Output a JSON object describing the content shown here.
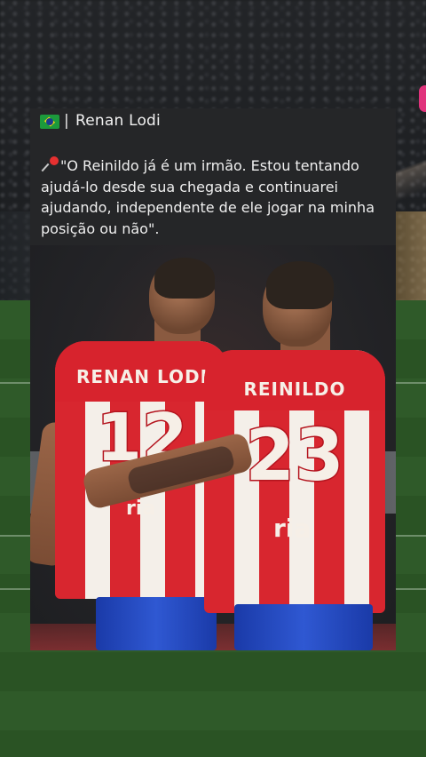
{
  "post": {
    "author_name": "Renan Lodi",
    "separator": "|",
    "flag_icon": "brazil-flag-icon",
    "pin_icon": "round-pushpin-icon",
    "quote": "\"O Reinildo já é um irmão. Estou tentando ajudá-lo desde sua chegada e continuarei ajudando, independente de ele jogar na minha posição ou não\"."
  },
  "photo": {
    "left_player": {
      "jersey_name": "RENAN LODI",
      "jersey_number": "12",
      "sponsor": "ria"
    },
    "right_player": {
      "jersey_name": "REINILDO",
      "jersey_number": "23",
      "sponsor": "ria"
    }
  },
  "colors": {
    "card_bg": "#252628",
    "jersey_red": "#d8262f",
    "jersey_white": "#f4efe9",
    "shorts_blue": "#2f58d2",
    "pitch_green": "#2f5a29"
  }
}
